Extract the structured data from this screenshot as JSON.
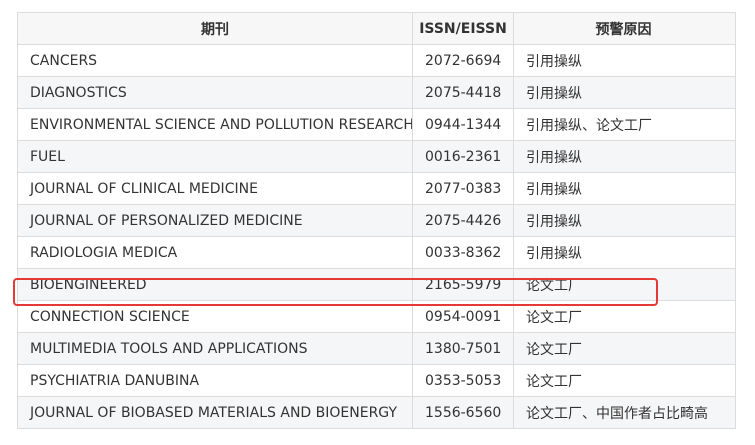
{
  "table": {
    "headers": [
      "期刊",
      "ISSN/EISSN",
      "预警原因"
    ],
    "rows": [
      {
        "journal": "CANCERS",
        "issn": "2072-6694",
        "reason": "引用操纵"
      },
      {
        "journal": "DIAGNOSTICS",
        "issn": "2075-4418",
        "reason": "引用操纵"
      },
      {
        "journal": "ENVIRONMENTAL SCIENCE AND POLLUTION RESEARCH",
        "issn": "0944-1344",
        "reason": "引用操纵、论文工厂"
      },
      {
        "journal": "FUEL",
        "issn": "0016-2361",
        "reason": "引用操纵"
      },
      {
        "journal": "JOURNAL OF CLINICAL MEDICINE",
        "issn": "2077-0383",
        "reason": "引用操纵"
      },
      {
        "journal": "JOURNAL OF PERSONALIZED MEDICINE",
        "issn": "2075-4426",
        "reason": "引用操纵"
      },
      {
        "journal": "RADIOLOGIA MEDICA",
        "issn": "0033-8362",
        "reason": "引用操纵"
      },
      {
        "journal": "BIOENGINEERED",
        "issn": "2165-5979",
        "reason": "论文工厂"
      },
      {
        "journal": "CONNECTION SCIENCE",
        "issn": "0954-0091",
        "reason": "论文工厂"
      },
      {
        "journal": "MULTIMEDIA TOOLS AND APPLICATIONS",
        "issn": "1380-7501",
        "reason": "论文工厂"
      },
      {
        "journal": "PSYCHIATRIA DANUBINA",
        "issn": "0353-5053",
        "reason": "论文工厂"
      },
      {
        "journal": "JOURNAL OF BIOBASED MATERIALS AND BIOENERGY",
        "issn": "1556-6560",
        "reason": "论文工厂、中国作者占比畸高"
      }
    ]
  },
  "colors": {
    "highlight_border": "#e53935",
    "header_bg": "#f7f7f7",
    "alt_row_bg": "#f5f6f7"
  }
}
